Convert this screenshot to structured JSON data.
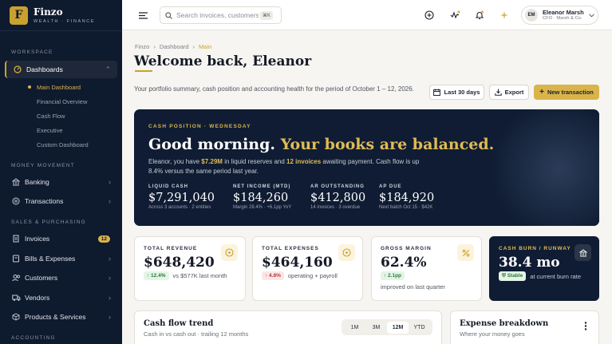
{
  "brand": {
    "logo_letter": "F",
    "name": "Finzo",
    "tagline": "WEALTH · FINANCE"
  },
  "sidebar": {
    "section_workspace": "WORKSPACE",
    "dashboards": "Dashboards",
    "dashboard_items": [
      "Main Dashboard",
      "Financial Overview",
      "Cash Flow",
      "Executive",
      "Custom Dashboard"
    ],
    "section_money": "MONEY MOVEMENT",
    "banking": "Banking",
    "transactions": "Transactions",
    "section_sales": "SALES & PURCHASING",
    "invoices": "Invoices",
    "invoices_badge": "12",
    "bills": "Bills & Expenses",
    "customers": "Customers",
    "vendors": "Vendors",
    "products": "Products & Services",
    "section_accounting": "ACCOUNTING"
  },
  "topbar": {
    "search_placeholder": "Search invoices, customers, accounts",
    "search_shortcut": "⌘K",
    "user_initials": "EM",
    "user_name": "Eleanor Marsh",
    "user_role": "CFO · Marsh & Co."
  },
  "breadcrumb": [
    "Finzo",
    "Dashboard",
    "Main"
  ],
  "page": {
    "title": "Welcome back, Eleanor",
    "subtitle": "Your portfolio summary, cash position and accounting health for the period of October 1 – 12, 2026.",
    "range_button": "Last 30 days",
    "export_button": "Export",
    "new_button": "New transaction"
  },
  "hero": {
    "eyebrow": "CASH POSITION · WEDNESDAY",
    "title_a": "Good morning.",
    "title_b": "Your books are balanced.",
    "text_1": "Eleanor, you have ",
    "text_amount": "$7.29M",
    "text_2": " in liquid reserves and ",
    "text_invoices": "12 invoices",
    "text_3": " awaiting payment. Cash flow is up 8.4% versus the same period last year.",
    "stats": [
      {
        "label": "LIQUID CASH",
        "value": "$7,291,040",
        "note": "Across 3 accounts · 2 entities"
      },
      {
        "label": "NET INCOME (MTD)",
        "value": "$184,260",
        "note": "Margin 28.4% · +6.1pp YoY"
      },
      {
        "label": "AR OUTSTANDING",
        "value": "$412,800",
        "note": "14 invoices · 3 overdue"
      },
      {
        "label": "AP DUE",
        "value": "$184,920",
        "note": "Next batch Oct 15 · $42K"
      }
    ]
  },
  "kpis": [
    {
      "label": "TOTAL REVENUE",
      "value": "$648,420",
      "delta": "↑ 12.4%",
      "note": "vs $577K last month"
    },
    {
      "label": "TOTAL EXPENSES",
      "value": "$464,160",
      "delta": "↑ 4.8%",
      "note": "operating + payroll"
    },
    {
      "label": "GROSS MARGIN",
      "value": "62.4%",
      "delta": "↑ 2.1pp",
      "note": "improved on last quarter"
    },
    {
      "label": "CASH BURN / RUNWAY",
      "value": "38.4 mo",
      "delta": "Stable",
      "note": "at current burn rate"
    }
  ],
  "cashflow": {
    "title": "Cash flow trend",
    "subtitle": "Cash in vs cash out · trailing 12 months",
    "ranges": [
      "1M",
      "3M",
      "12M",
      "YTD"
    ]
  },
  "expenses": {
    "title": "Expense breakdown",
    "subtitle": "Where your money goes"
  }
}
